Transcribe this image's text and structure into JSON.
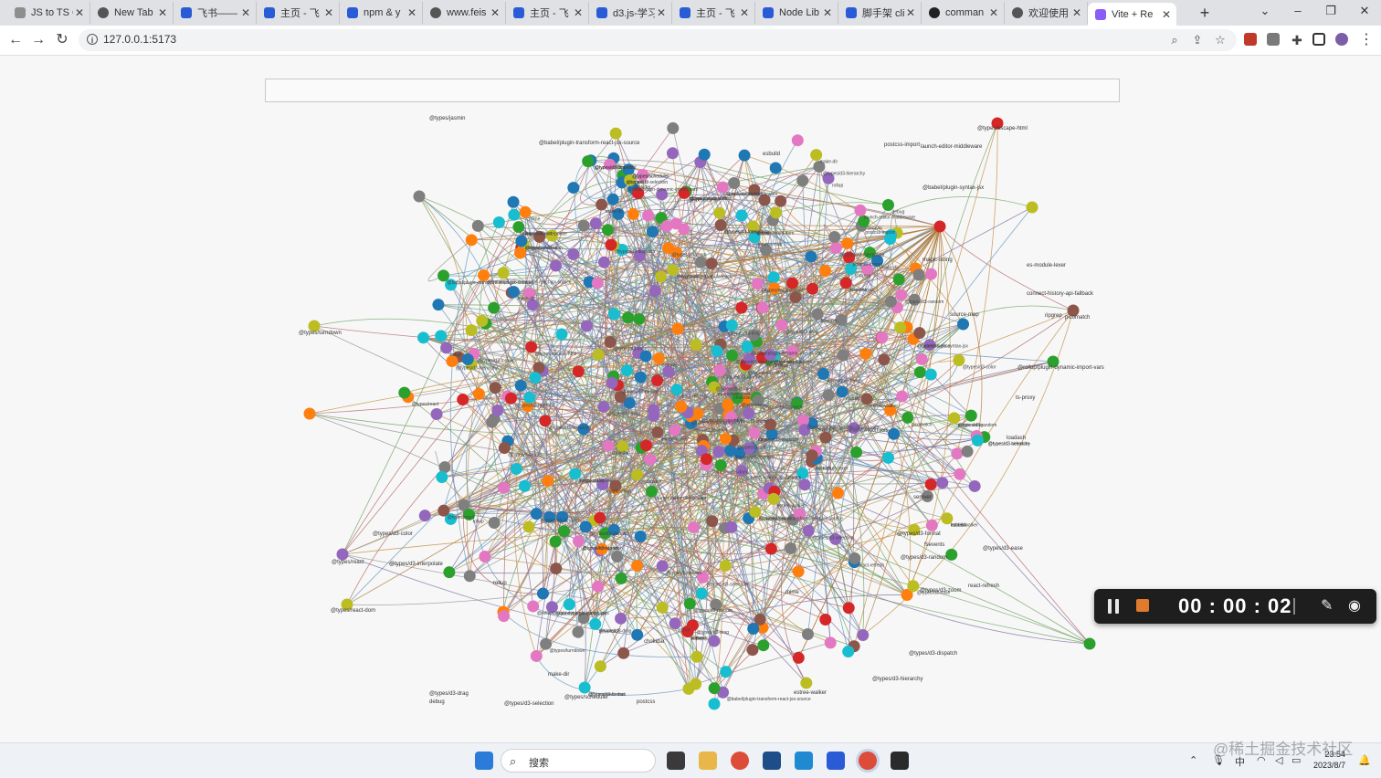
{
  "tabs": [
    {
      "label": "JS to TS C",
      "icon": "document-icon",
      "color": "#8e8e8e"
    },
    {
      "label": "New Tab",
      "icon": "globe-icon",
      "color": "#555555"
    },
    {
      "label": "飞书——",
      "icon": "feishu-icon",
      "color": "#2a5bd7"
    },
    {
      "label": "主页 - 飞",
      "icon": "feishu-icon",
      "color": "#2a5bd7"
    },
    {
      "label": "npm & y",
      "icon": "document-icon",
      "color": "#2a5bd7"
    },
    {
      "label": "www.feis",
      "icon": "globe-icon",
      "color": "#555555"
    },
    {
      "label": "主页 - 飞",
      "icon": "feishu-icon",
      "color": "#2a5bd7"
    },
    {
      "label": "d3.js-学习",
      "icon": "document-icon",
      "color": "#2a5bd7"
    },
    {
      "label": "主页 - 飞",
      "icon": "feishu-icon",
      "color": "#2a5bd7"
    },
    {
      "label": "Node Lib",
      "icon": "document-icon",
      "color": "#2a5bd7"
    },
    {
      "label": "脚手架 cli",
      "icon": "document-icon",
      "color": "#2a5bd7"
    },
    {
      "label": "comman",
      "icon": "github-icon",
      "color": "#222222"
    },
    {
      "label": "欢迎使用",
      "icon": "globe-icon",
      "color": "#555555"
    },
    {
      "label": "Vite + Re",
      "icon": "vite-icon",
      "color": "#8b5cf6",
      "active": true
    }
  ],
  "address_bar": {
    "url": "127.0.0.1:5173"
  },
  "search_box": {
    "value": ""
  },
  "graph": {
    "node_colors": [
      "#1f77b4",
      "#ff7f0e",
      "#2ca02c",
      "#d62728",
      "#9467bd",
      "#8c564b",
      "#e377c2",
      "#7f7f7f",
      "#bcbd22",
      "#17becf"
    ],
    "labels": [
      "@types/jasmin",
      "@babel/plugin-transform-react-jsx-source",
      "postcss-import",
      "launch-editor-middleware",
      "@types/escape-html",
      "@types/d3-format",
      "@babel/plugin-syntax-jsx",
      "es-module-lexer",
      "@rollup/plugin-dynamic-import-vars",
      "ripgrep",
      "@types/turndown",
      "@types/react",
      "@types/react-dom",
      "@types/d3-color",
      "@types/d3-interpolate",
      "@types/d3-drag",
      "@types/d3-selection",
      "@types/scheduler",
      "@types/d3-dispatch",
      "@types/d3-hierarchy",
      "@types/d3-zoom",
      "@types/d3-random",
      "picomatch",
      "ts-proxy",
      "magic-string",
      "connect-history-api-fallback",
      "postcss",
      "estree-walker",
      "semver",
      "loadash",
      "make-dir",
      "mime",
      "debug",
      "source-map",
      "esbuild",
      "rollup",
      "chokidar",
      "react-refresh",
      "fsevents",
      "@types/d3-ease"
    ]
  },
  "recorder": {
    "time": "00 : 00 : 02"
  },
  "taskbar": {
    "search_placeholder": "搜索",
    "ime": "中",
    "clock_time": "23:54",
    "clock_date": "2023/8/7"
  },
  "watermark": "@稀土掘金技术社区"
}
